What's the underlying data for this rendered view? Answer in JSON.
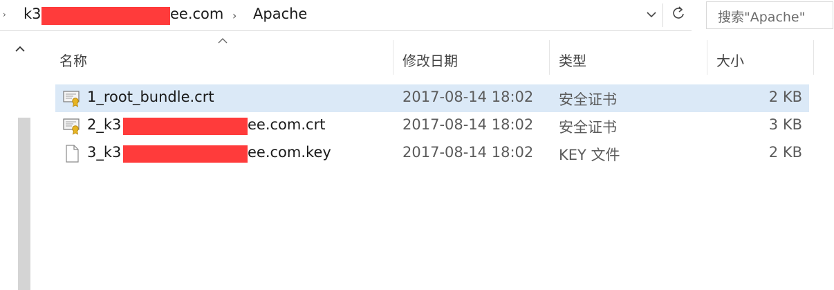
{
  "toolbar": {
    "crumbs": {
      "domain_left": "k3",
      "domain_right": "ee.com",
      "separator": "›",
      "current": "Apache"
    },
    "dropdown_icon": "chevron-down-icon",
    "refresh_icon": "refresh-icon",
    "search_placeholder": "搜索\"Apache\""
  },
  "columns": {
    "name": "名称",
    "modified": "修改日期",
    "type": "类型",
    "size": "大小",
    "sorted_column": "name"
  },
  "files": [
    {
      "prefix": "1_root_bundle.crt",
      "suffix": "",
      "redacted": false,
      "date": "2017-08-14 18:02",
      "type": "安全证书",
      "size": "2 KB",
      "icon": "certificate-icon",
      "selected": true
    },
    {
      "prefix": "2_k3",
      "suffix": "ee.com.crt",
      "redacted": true,
      "date": "2017-08-14 18:02",
      "type": "安全证书",
      "size": "3 KB",
      "icon": "certificate-icon",
      "selected": false
    },
    {
      "prefix": "3_k3",
      "suffix": "ee.com.key",
      "redacted": true,
      "date": "2017-08-14 18:02",
      "type": "KEY 文件",
      "size": "2 KB",
      "icon": "file-icon",
      "selected": false
    }
  ],
  "colors": {
    "selection": "#dbe9f7",
    "redaction": "#ff3b3b",
    "scrollbar": "#d4d4d4"
  }
}
